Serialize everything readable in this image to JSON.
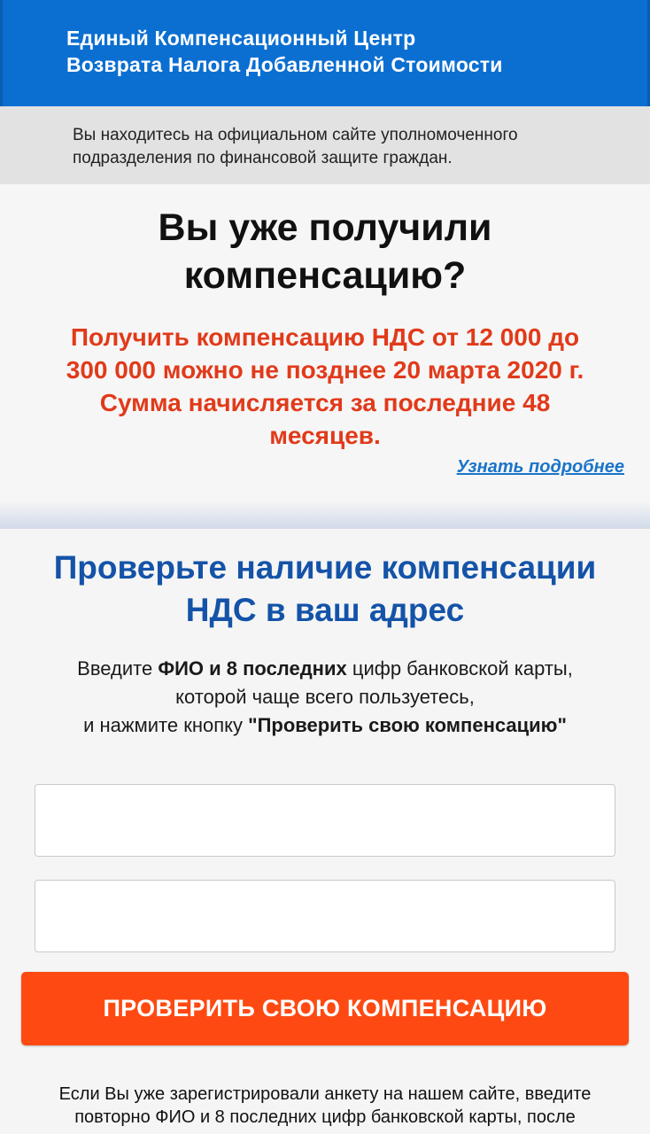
{
  "header": {
    "title_line1": "Единый Компенсационный Центр",
    "title_line2": "Возврата Налога Добавленной Стоимости"
  },
  "notice": {
    "line1": "Вы находитесь на официальном сайте уполномоченного",
    "line2": "подразделения по финансовой защите граждан."
  },
  "hero": {
    "title_line1": "Вы уже получили",
    "title_line2": "компенсацию?",
    "offer_line1": "Получить компенсацию НДС от 12 000 до",
    "offer_line2": "300 000 можно не позднее 20 марта 2020 г.",
    "offer_line3": "Сумма начисляется за последние 48",
    "offer_line4": "месяцев.",
    "more_link": "Узнать подробнее"
  },
  "form": {
    "title_line1": "Проверьте наличие компенсации",
    "title_line2": "НДС в ваш адрес",
    "instr1_a": "Введите ",
    "instr1_b": "ФИО и 8 последних",
    "instr1_c": " цифр банковской карты,",
    "instr2": "которой чаще всего пользуетесь,",
    "instr3_a": "и нажмите кнопку ",
    "instr3_b": "\"Проверить свою компенсацию\"",
    "name_value": "",
    "card_value": "",
    "submit_label": "ПРОВЕРИТЬ СВОЮ КОМПЕНСАЦИЮ"
  },
  "footer": {
    "line1": "Если Вы уже зарегистрировали анкету на нашем сайте, введите",
    "line2": "повторно ФИО и 8 последних цифр банковской карты, после"
  },
  "colors": {
    "header_bg": "#0b6fd1",
    "offer_red": "#e13a1a",
    "form_title_blue": "#1453a8",
    "link_blue": "#1a74c9",
    "button_orange": "#fe4a12"
  }
}
